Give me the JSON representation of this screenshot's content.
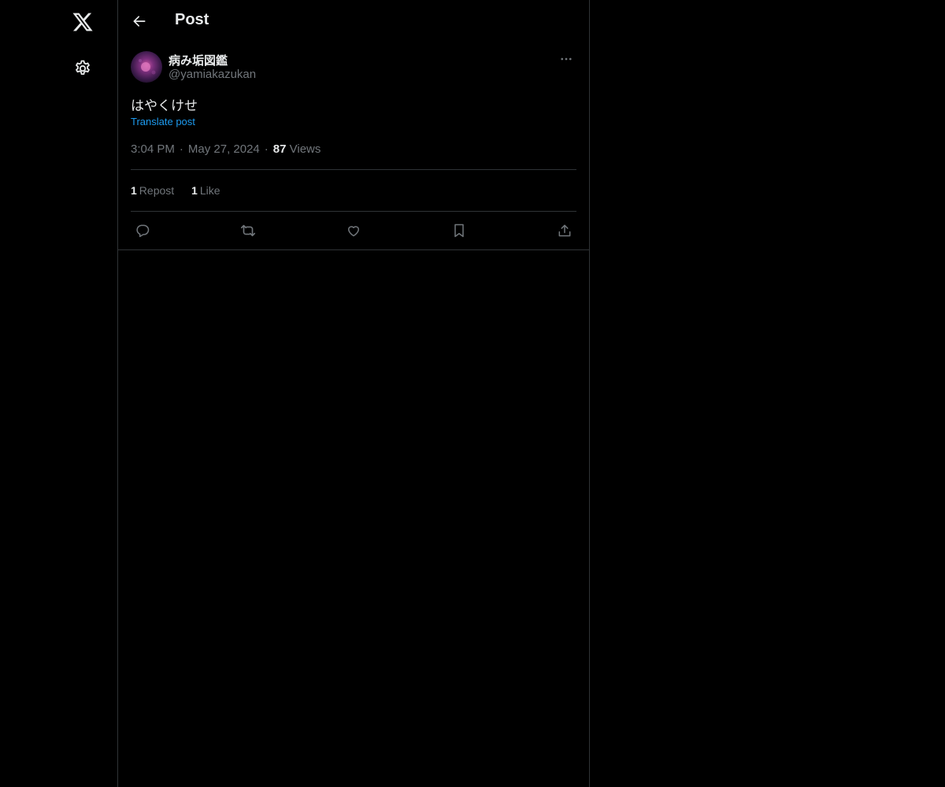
{
  "nav": {
    "logo_icon": "x-logo-icon",
    "settings_icon": "gear-icon"
  },
  "header": {
    "back_icon": "arrow-left-icon",
    "title": "Post"
  },
  "post": {
    "author": {
      "name": "病み垢図鑑",
      "handle": "@yamiakazukan"
    },
    "more_icon": "ellipsis-icon",
    "text": "はやくけせ",
    "translate_label": "Translate post",
    "time": "3:04 PM",
    "date": "May 27, 2024",
    "views_count": "87",
    "views_label": "Views",
    "separator": "·",
    "reposts_count": "1",
    "reposts_label": "Repost",
    "likes_count": "1",
    "likes_label": "Like",
    "actions": [
      {
        "icon": "reply-icon"
      },
      {
        "icon": "repost-icon"
      },
      {
        "icon": "heart-icon"
      },
      {
        "icon": "bookmark-icon"
      },
      {
        "icon": "share-icon"
      }
    ]
  },
  "colors": {
    "background": "#000000",
    "text": "#e7e9ea",
    "muted": "#71767b",
    "link": "#1d9bf0",
    "border": "#2f3336"
  }
}
